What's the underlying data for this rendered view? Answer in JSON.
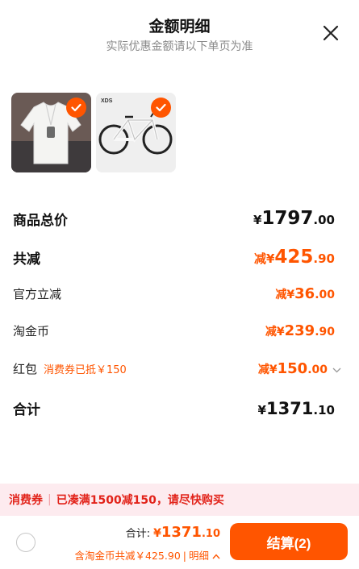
{
  "header": {
    "title": "金额明细",
    "subtitle": "实际优惠金额请以下单页为准"
  },
  "products": [
    {
      "name": "white-shirt",
      "selected": true
    },
    {
      "name": "bicycle",
      "selected": true
    }
  ],
  "rows": {
    "goods_total": {
      "label": "商品总价",
      "prefix": "¥",
      "int": "1797",
      "dec": ".00"
    },
    "total_discount": {
      "label": "共减",
      "prefix": "减¥",
      "int": "425",
      "dec": ".90"
    },
    "official_discount": {
      "label": "官方立减",
      "prefix": "减¥",
      "int": "36",
      "dec": ".00"
    },
    "taojinbi": {
      "label": "淘金币",
      "prefix": "减¥",
      "int": "239",
      "dec": ".90"
    },
    "red_packet": {
      "label": "红包",
      "tag": "消费券已抵￥150",
      "prefix": "减¥",
      "int": "150",
      "dec": ".00"
    },
    "sum": {
      "label": "合计",
      "prefix": "¥",
      "int": "1371",
      "dec": ".10"
    }
  },
  "coupon_bar": {
    "label": "消费券",
    "sep": "|",
    "text": "已凑满1500减150，请尽快购买"
  },
  "footer": {
    "total_label": "合计:",
    "total_prefix": "¥",
    "total_int": "1371",
    "total_dec": ".10",
    "detail_text": "含淘金币共减￥425.90",
    "detail_sep": "|",
    "detail_link": "明细",
    "checkout_label": "结算(2)"
  },
  "colors": {
    "accent": "#ff5500",
    "coupon_bg": "#fdebef",
    "coupon_text": "#e2231a"
  }
}
